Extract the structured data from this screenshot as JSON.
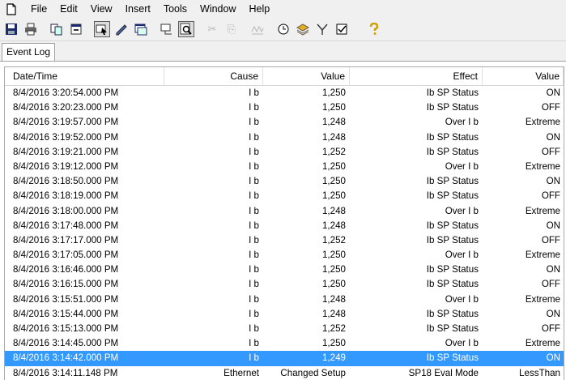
{
  "menu": {
    "items": [
      "File",
      "Edit",
      "View",
      "Insert",
      "Tools",
      "Window",
      "Help"
    ]
  },
  "toolbar": {
    "icons": [
      "save-icon",
      "print-icon",
      "copy-icon",
      "properties-icon",
      "select-icon",
      "edit-icon",
      "window-icon",
      "connect-icon",
      "zoom-icon",
      "cut-icon",
      "paste-icon",
      "chart-icon",
      "clock-icon",
      "layers-icon",
      "filter-icon",
      "checkbox-icon",
      "help-icon"
    ]
  },
  "tabs": [
    {
      "label": "Event Log"
    }
  ],
  "table": {
    "columns": [
      "Date/Time",
      "Cause",
      "Value",
      "Effect",
      "Value"
    ],
    "rows": [
      [
        "8/4/2016 3:20:54.000 PM",
        "I b",
        "1,250",
        "Ib SP Status",
        "ON"
      ],
      [
        "8/4/2016 3:20:23.000 PM",
        "I b",
        "1,250",
        "Ib SP Status",
        "OFF"
      ],
      [
        "8/4/2016 3:19:57.000 PM",
        "I b",
        "1,248",
        "Over I b",
        "Extreme"
      ],
      [
        "8/4/2016 3:19:52.000 PM",
        "I b",
        "1,248",
        "Ib SP Status",
        "ON"
      ],
      [
        "8/4/2016 3:19:21.000 PM",
        "I b",
        "1,252",
        "Ib SP Status",
        "OFF"
      ],
      [
        "8/4/2016 3:19:12.000 PM",
        "I b",
        "1,250",
        "Over I b",
        "Extreme"
      ],
      [
        "8/4/2016 3:18:50.000 PM",
        "I b",
        "1,250",
        "Ib SP Status",
        "ON"
      ],
      [
        "8/4/2016 3:18:19.000 PM",
        "I b",
        "1,250",
        "Ib SP Status",
        "OFF"
      ],
      [
        "8/4/2016 3:18:00.000 PM",
        "I b",
        "1,248",
        "Over I b",
        "Extreme"
      ],
      [
        "8/4/2016 3:17:48.000 PM",
        "I b",
        "1,248",
        "Ib SP Status",
        "ON"
      ],
      [
        "8/4/2016 3:17:17.000 PM",
        "I b",
        "1,252",
        "Ib SP Status",
        "OFF"
      ],
      [
        "8/4/2016 3:17:05.000 PM",
        "I b",
        "1,250",
        "Over I b",
        "Extreme"
      ],
      [
        "8/4/2016 3:16:46.000 PM",
        "I b",
        "1,250",
        "Ib SP Status",
        "ON"
      ],
      [
        "8/4/2016 3:16:15.000 PM",
        "I b",
        "1,250",
        "Ib SP Status",
        "OFF"
      ],
      [
        "8/4/2016 3:15:51.000 PM",
        "I b",
        "1,248",
        "Over I b",
        "Extreme"
      ],
      [
        "8/4/2016 3:15:44.000 PM",
        "I b",
        "1,248",
        "Ib SP Status",
        "ON"
      ],
      [
        "8/4/2016 3:15:13.000 PM",
        "I b",
        "1,252",
        "Ib SP Status",
        "OFF"
      ],
      [
        "8/4/2016 3:14:45.000 PM",
        "I b",
        "1,250",
        "Over I b",
        "Extreme"
      ],
      [
        "8/4/2016 3:14:42.000 PM",
        "I b",
        "1,249",
        "Ib SP Status",
        "ON"
      ],
      [
        "8/4/2016 3:14:11.148 PM",
        "Ethernet",
        "Changed Setup",
        "SP18 Eval Mode",
        "LessThan"
      ]
    ],
    "selected_row": 18
  },
  "colors": {
    "selection": "#3399ff",
    "chrome": "#f0f0f0"
  }
}
